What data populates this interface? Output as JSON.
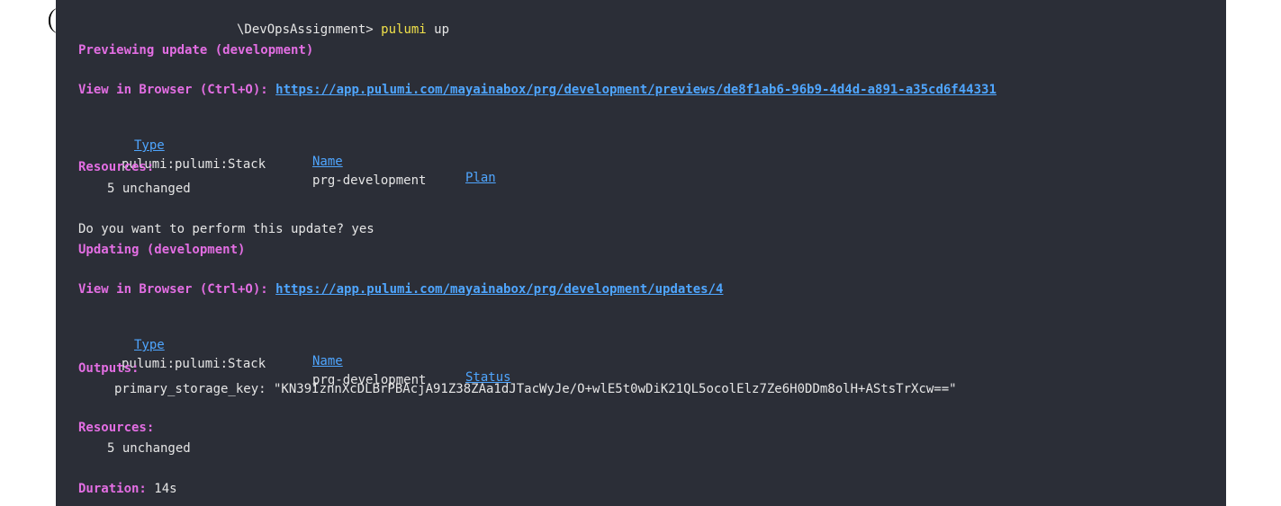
{
  "terminal": {
    "prompt_path": "\\DevOpsAssignment>",
    "command_name": "pulumi",
    "command_arg": "up",
    "preview_title": "Previewing update (development)",
    "view_label": "View in Browser (Ctrl+O):",
    "preview_url": "https://app.pulumi.com/mayainabox/prg/development/previews/de8f1ab6-96b9-4d4d-a891-a35cd6f44331",
    "preview_table": {
      "headers": [
        "Type",
        "Name",
        "Plan"
      ],
      "row": [
        "pulumi:pulumi:Stack",
        "prg-development"
      ]
    },
    "resources_label": "Resources:",
    "resources_value": "5 unchanged",
    "confirm_question": "Do you want to perform this update? yes",
    "update_title": "Updating (development)",
    "update_url": "https://app.pulumi.com/mayainabox/prg/development/updates/4",
    "update_table": {
      "headers": [
        "Type",
        "Name",
        "Status"
      ],
      "row": [
        "pulumi:pulumi:Stack",
        "prg-development"
      ]
    },
    "outputs_label": "Outputs:",
    "output_key_line": "primary_storage_key: \"KN39IznnXcDLBrPBAcjA91Z38ZAa1dJTacWyJe/O+wlE5t0wDiK21QL5ocolElz7Ze6H0DDm8olH+AStsTrXcw==\"",
    "resources2_label": "Resources:",
    "resources2_value": "5 unchanged",
    "duration_label": "Duration:",
    "duration_value": "14s"
  }
}
